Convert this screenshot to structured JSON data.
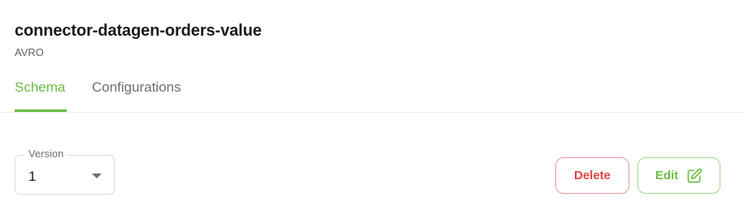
{
  "header": {
    "title": "connector-datagen-orders-value",
    "subtitle": "AVRO"
  },
  "tabs": [
    {
      "label": "Schema",
      "active": true
    },
    {
      "label": "Configurations",
      "active": false
    }
  ],
  "version": {
    "label": "Version",
    "selected": "1"
  },
  "actions": {
    "delete_label": "Delete",
    "edit_label": "Edit",
    "edit_icon": "edit-pencil-icon"
  },
  "colors": {
    "accent": "#6cbd45",
    "danger": "#e0443e"
  }
}
